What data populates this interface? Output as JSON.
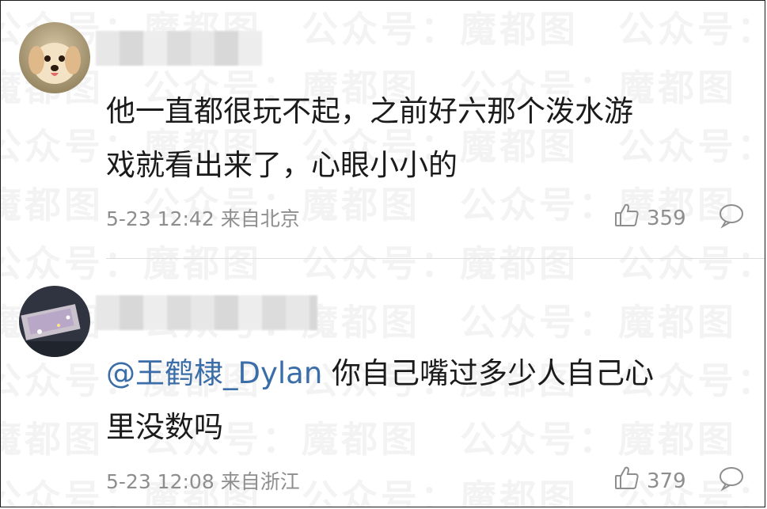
{
  "watermark_text": "公众号：魔都图",
  "comments": [
    {
      "username": "",
      "text": "他一直都很玩不起，之前好六那个泼水游戏就看出来了，心眼小小的",
      "text_line1": "他一直都很玩不起，之前好六那个泼水游",
      "text_line2": "戏就看出来了，心眼小小的",
      "timestamp": "5-23 12:42",
      "source": "来自北京",
      "likes": "359",
      "avatar_icon": "puppy-avatar-icon"
    },
    {
      "username": "",
      "mention": "@王鹤棣_Dylan",
      "text_line1": " 你自己嘴过多少人自己心",
      "text_line2": "里没数吗",
      "timestamp": "5-23 12:08",
      "source": "来自浙江",
      "likes": "379",
      "avatar_icon": "photo-avatar-icon"
    }
  ],
  "colors": {
    "mention": "#3b6ea8",
    "meta": "#8e8e8e",
    "text": "#1b1b1b"
  }
}
